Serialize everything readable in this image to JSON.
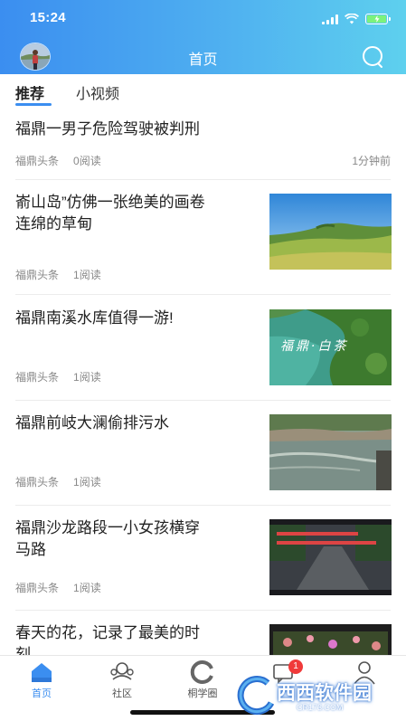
{
  "status_bar": {
    "time": "15:24"
  },
  "header": {
    "title": "首页"
  },
  "tabs": [
    {
      "label": "推荐",
      "active": true
    },
    {
      "label": "小视频",
      "active": false
    }
  ],
  "feed": [
    {
      "title_lines": [
        "福鼎一男子危险驾驶被判刑"
      ],
      "source": "福鼎头条",
      "reads": "0阅读",
      "time": "1分钟前",
      "has_thumb": false
    },
    {
      "title_lines": [
        "嵛山岛”仿佛一张绝美的画卷",
        "连绵的草甸"
      ],
      "source": "福鼎头条",
      "reads": "1阅读",
      "has_thumb": true,
      "thumb_icon": "grassland-island-photo"
    },
    {
      "title_lines": [
        "福鼎南溪水库值得一游!"
      ],
      "source": "福鼎头条",
      "reads": "1阅读",
      "has_thumb": true,
      "thumb_icon": "reservoir-photo",
      "thumb_caption": "福鼎·白茶"
    },
    {
      "title_lines": [
        "福鼎前岐大澜偷排污水"
      ],
      "source": "福鼎头条",
      "reads": "1阅读",
      "has_thumb": true,
      "thumb_icon": "river-outfall-photo"
    },
    {
      "title_lines": [
        "福鼎沙龙路段一小女孩横穿",
        "马路"
      ],
      "source": "福鼎头条",
      "reads": "1阅读",
      "has_thumb": true,
      "thumb_icon": "road-dashcam-photo"
    },
    {
      "title_lines": [
        "春天的花，记录了最美的时",
        "刻"
      ],
      "has_thumb": true,
      "thumb_icon": "spring-flowers-photo"
    }
  ],
  "bottom_nav": [
    {
      "label": "首页",
      "icon": "home-icon",
      "active": true
    },
    {
      "label": "社区",
      "icon": "community-icon",
      "active": false
    },
    {
      "label": "桐学圈",
      "icon": "circle-icon",
      "active": false
    },
    {
      "label": "",
      "icon": "message-icon",
      "active": false,
      "badge": "1"
    },
    {
      "label": "",
      "icon": "profile-icon",
      "active": false
    }
  ],
  "watermark": {
    "text": "西西软件园",
    "url": "CR173.COM"
  },
  "colors": {
    "accent": "#3b8ef0",
    "badge": "#f03a3a"
  }
}
